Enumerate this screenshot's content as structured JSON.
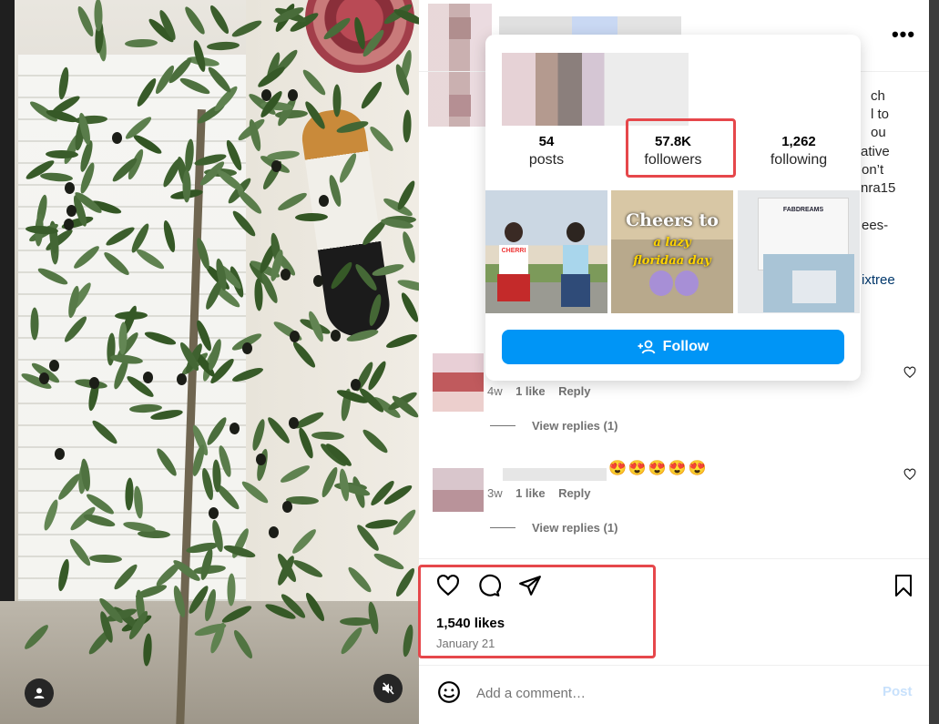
{
  "header": {
    "more_label": "•••"
  },
  "caption": {
    "fragments": [
      "ch",
      "l to",
      "ou",
      "ative",
      "on’t",
      "nra15",
      "ees-"
    ],
    "link_fragment": "ixtree"
  },
  "profile_card": {
    "posts_count": "54",
    "posts_label": "posts",
    "followers_count": "57.8K",
    "followers_label": "followers",
    "following_count": "1,262",
    "following_label": "following",
    "thumb2_caption_line1": "Cheers to",
    "thumb2_caption_line2": "a lazy",
    "thumb2_caption_line3": "floridaa day",
    "thumb1_shirt_text": "CHERRI",
    "thumb3_brand": "FABDREAMS",
    "follow_label": "Follow"
  },
  "comments": [
    {
      "age": "4w",
      "likes": "1 like",
      "reply": "Reply",
      "view_replies": "View replies (1)"
    },
    {
      "age": "3w",
      "likes": "1 like",
      "reply": "Reply",
      "view_replies": "View replies (1)",
      "emojis": "😍😍😍😍😍"
    }
  ],
  "post": {
    "likes": "1,540 likes",
    "date": "January 21",
    "comment_placeholder": "Add a comment…",
    "post_label": "Post"
  },
  "colors": {
    "accent": "#0095f6",
    "annotation": "#e6474b"
  }
}
